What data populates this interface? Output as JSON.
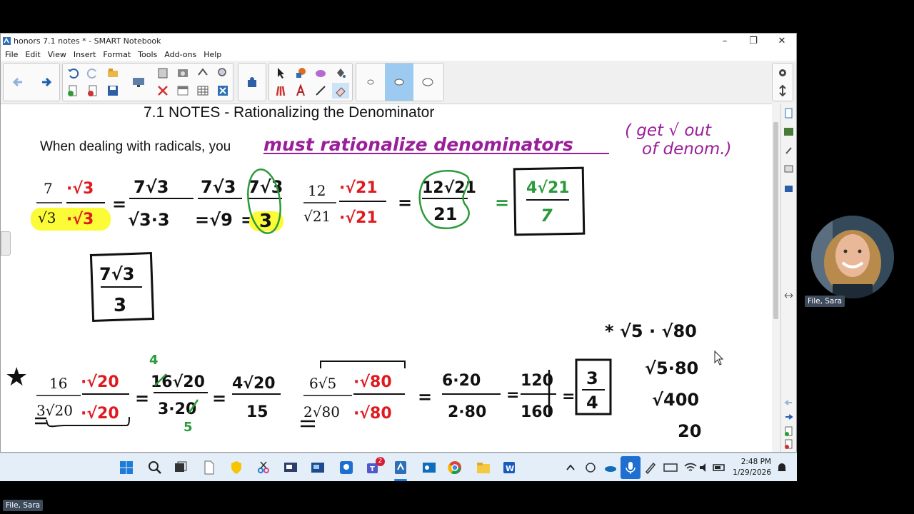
{
  "window": {
    "title": "honors 7.1 notes * - SMART Notebook",
    "minimize": "–",
    "restore": "❐",
    "close": "✕"
  },
  "menu": [
    "File",
    "Edit",
    "View",
    "Insert",
    "Format",
    "Tools",
    "Add-ons",
    "Help"
  ],
  "toolbar": {
    "icons": [
      "back-icon",
      "forward-icon",
      "undo-icon",
      "redo-icon",
      "open-icon",
      "new-page-icon",
      "delete-page-icon",
      "save-icon",
      "display-icon",
      "paste-icon",
      "screen-capture-icon",
      "full-screen-icon",
      "delete-icon",
      "screen-shade-icon",
      "table-icon",
      "close-icon",
      "add-ons-icon",
      "select-icon",
      "shapes-icon",
      "magic-pen-icon",
      "fill-icon",
      "pens-icon",
      "text-icon",
      "line-icon",
      "eraser-icon",
      "ink-thin-icon",
      "ink-medium-icon",
      "ink-thick-icon",
      "gear-icon",
      "move-toolbar-icon"
    ]
  },
  "notes": {
    "title": "7.1 NOTES - Rationalizing the Denominator",
    "intro": "When dealing with radicals, you",
    "must": "must rationalize denominators",
    "aside_line1": "( get √ out",
    "aside_line2": "of denom.)",
    "ex1": {
      "num": "7",
      "den": "√3",
      "mult": "·√3",
      "step1_num": "7√3",
      "step1_den": "√3·3",
      "step2_num": "7√3",
      "step2_den": "=√9",
      "step3_num": "7√3",
      "step3_den": "3",
      "boxed_num": "7√3",
      "boxed_den": "3"
    },
    "ex2": {
      "num": "12",
      "den": "√21",
      "mult": "·√21",
      "step1_num": "12√21",
      "step1_den": "21",
      "answer_num": "4√21",
      "answer_den": "7"
    },
    "ex3": {
      "star": "★",
      "num": "16",
      "den": "3√20",
      "mult": "·√20",
      "s1_num": "16√20",
      "s1_den": "3·20",
      "s1_over": "4",
      "s1_under": "5",
      "s2_num": "4√20",
      "s2_den": "15"
    },
    "ex4": {
      "num": "6√5",
      "den": "2√80",
      "mult": "·√80",
      "s1_num": "6·20",
      "s1_den": "2·80",
      "s2_num": "120",
      "s2_den": "160",
      "ans_num": "3",
      "ans_den": "4"
    },
    "side": {
      "line1": "* √5 · √80",
      "line2": "√5·80",
      "line3": "√400",
      "line4": "20"
    }
  },
  "taskbar": {
    "icons": [
      "windows-start-icon",
      "search-icon",
      "task-view-icon",
      "file-icon",
      "norton-icon",
      "snipping-tool-icon",
      "smart-board-icon",
      "cam-icon",
      "map-icon",
      "teams-icon",
      "notebook-icon",
      "outlook-icon",
      "chrome-icon",
      "file-explorer-icon",
      "word-icon"
    ],
    "teams_badge": "2",
    "time": "2:48 PM",
    "date": "1/29/2026"
  },
  "participant": {
    "name": "File, Sara"
  },
  "colors": {
    "red": "#e0191f",
    "green": "#2b9a3a",
    "purple": "#9a1e9a",
    "highlight": "#fbfb37",
    "ink": "#111111"
  }
}
